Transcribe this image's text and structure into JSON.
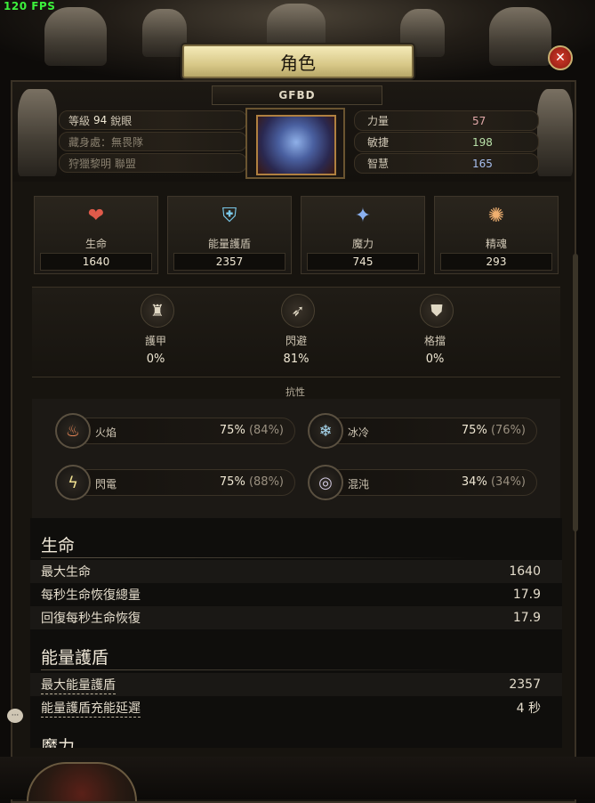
{
  "fps": "120 FPS",
  "window": {
    "title": "角色",
    "close_glyph": "✕"
  },
  "character": {
    "name": "GFBD",
    "level_label": "等級",
    "level": "94",
    "class": "銳眼",
    "hideout": "藏身處：無畏隊",
    "league": "狩獵黎明 聯盟"
  },
  "attributes": [
    {
      "label": "力量",
      "value": "57",
      "color": "#e0a8a8"
    },
    {
      "label": "敏捷",
      "value": "198",
      "color": "#b8e0a8"
    },
    {
      "label": "智慧",
      "value": "165",
      "color": "#a8c0f0"
    }
  ],
  "stats": [
    {
      "label": "生命",
      "value": "1640",
      "icon": "heart-icon",
      "glyph": "❤",
      "color": "#e05a4a"
    },
    {
      "label": "能量護盾",
      "value": "2357",
      "icon": "shield-icon",
      "glyph": "⛨",
      "color": "#7ac8e8"
    },
    {
      "label": "魔力",
      "value": "745",
      "icon": "mana-icon",
      "glyph": "✦",
      "color": "#8ab0f0"
    },
    {
      "label": "精魂",
      "value": "293",
      "icon": "spirit-icon",
      "glyph": "✺",
      "color": "#f0b070"
    }
  ],
  "defenses": [
    {
      "label": "護甲",
      "value": "0%",
      "icon": "armour-icon",
      "glyph": "♜"
    },
    {
      "label": "閃避",
      "value": "81%",
      "icon": "evasion-icon",
      "glyph": "➶"
    },
    {
      "label": "格擋",
      "value": "0%",
      "icon": "block-icon",
      "glyph": "⛊"
    }
  ],
  "resistances": {
    "title": "抗性",
    "items": [
      {
        "label": "火焰",
        "value": "75%",
        "max": "(84%)",
        "icon": "fire-icon",
        "glyph": "♨"
      },
      {
        "label": "冰冷",
        "value": "75%",
        "max": "(76%)",
        "icon": "cold-icon",
        "glyph": "❄"
      },
      {
        "label": "閃電",
        "value": "75%",
        "max": "(88%)",
        "icon": "lightning-icon",
        "glyph": "ϟ"
      },
      {
        "label": "混沌",
        "value": "34%",
        "max": "(34%)",
        "icon": "chaos-icon",
        "glyph": "◎"
      }
    ]
  },
  "details": {
    "life": {
      "title": "生命",
      "rows": [
        {
          "label": "最大生命",
          "value": "1640"
        },
        {
          "label": "每秒生命恢復總量",
          "value": "17.9"
        },
        {
          "label": "回復每秒生命恢復",
          "value": "17.9"
        }
      ]
    },
    "es": {
      "title": "能量護盾",
      "rows": [
        {
          "label": "最大能量護盾",
          "value": "2357"
        },
        {
          "label": "能量護盾充能延遲",
          "value": "4 秒"
        }
      ]
    },
    "mana_partial": "魔力"
  }
}
